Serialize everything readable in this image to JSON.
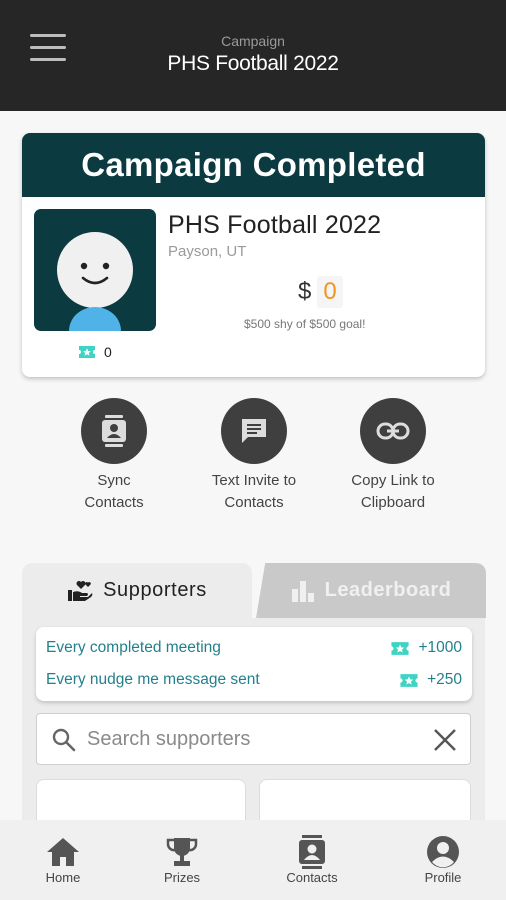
{
  "header": {
    "subtitle": "Campaign",
    "title": "PHS Football 2022",
    "menu_icon": "hamburger-menu-icon"
  },
  "campaign": {
    "banner": "Campaign Completed",
    "name": "PHS Football 2022",
    "location": "Payson, UT",
    "currency": "$",
    "raised": "0",
    "goal_text": "$500 shy of $500 goal!",
    "points": "0"
  },
  "actions": [
    {
      "label": "Sync Contacts",
      "icon": "contacts-icon"
    },
    {
      "label": "Text Invite to Contacts",
      "icon": "message-icon"
    },
    {
      "label": "Copy Link to Clipboard",
      "icon": "link-icon"
    }
  ],
  "tabs": {
    "supporters": "Supporters",
    "leaderboard": "Leaderboard"
  },
  "rewards": [
    {
      "label": "Every completed meeting",
      "points": "+1000"
    },
    {
      "label": "Every nudge me message sent",
      "points": "+250"
    }
  ],
  "search": {
    "placeholder": "Search supporters",
    "value": ""
  },
  "nav": [
    {
      "label": "Home",
      "icon": "home-icon"
    },
    {
      "label": "Prizes",
      "icon": "trophy-icon"
    },
    {
      "label": "Contacts",
      "icon": "contacts-icon"
    },
    {
      "label": "Profile",
      "icon": "profile-icon"
    }
  ],
  "colors": {
    "header_bg": "#262626",
    "brand_teal": "#0b3a40",
    "accent_orange": "#f29422",
    "reward_teal": "#22808c",
    "ticket": "#3fd3c4"
  }
}
